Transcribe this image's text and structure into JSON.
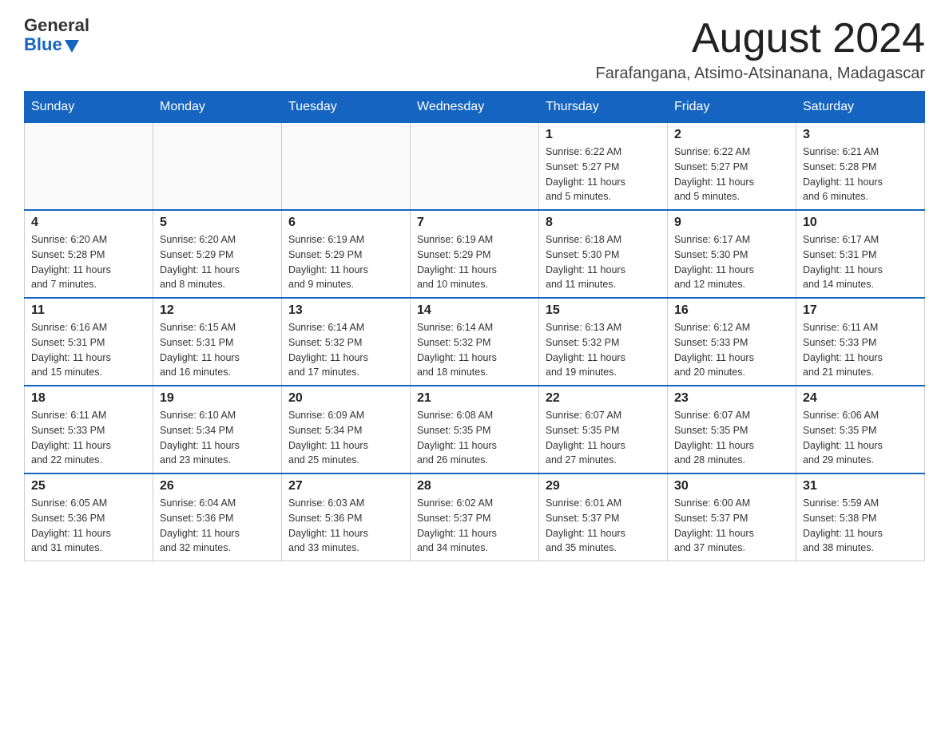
{
  "header": {
    "logo_general": "General",
    "logo_blue": "Blue",
    "month_year": "August 2024",
    "location": "Farafangana, Atsimo-Atsinanana, Madagascar"
  },
  "days_of_week": [
    "Sunday",
    "Monday",
    "Tuesday",
    "Wednesday",
    "Thursday",
    "Friday",
    "Saturday"
  ],
  "weeks": [
    {
      "days": [
        {
          "num": "",
          "info": ""
        },
        {
          "num": "",
          "info": ""
        },
        {
          "num": "",
          "info": ""
        },
        {
          "num": "",
          "info": ""
        },
        {
          "num": "1",
          "info": "Sunrise: 6:22 AM\nSunset: 5:27 PM\nDaylight: 11 hours\nand 5 minutes."
        },
        {
          "num": "2",
          "info": "Sunrise: 6:22 AM\nSunset: 5:27 PM\nDaylight: 11 hours\nand 5 minutes."
        },
        {
          "num": "3",
          "info": "Sunrise: 6:21 AM\nSunset: 5:28 PM\nDaylight: 11 hours\nand 6 minutes."
        }
      ]
    },
    {
      "days": [
        {
          "num": "4",
          "info": "Sunrise: 6:20 AM\nSunset: 5:28 PM\nDaylight: 11 hours\nand 7 minutes."
        },
        {
          "num": "5",
          "info": "Sunrise: 6:20 AM\nSunset: 5:29 PM\nDaylight: 11 hours\nand 8 minutes."
        },
        {
          "num": "6",
          "info": "Sunrise: 6:19 AM\nSunset: 5:29 PM\nDaylight: 11 hours\nand 9 minutes."
        },
        {
          "num": "7",
          "info": "Sunrise: 6:19 AM\nSunset: 5:29 PM\nDaylight: 11 hours\nand 10 minutes."
        },
        {
          "num": "8",
          "info": "Sunrise: 6:18 AM\nSunset: 5:30 PM\nDaylight: 11 hours\nand 11 minutes."
        },
        {
          "num": "9",
          "info": "Sunrise: 6:17 AM\nSunset: 5:30 PM\nDaylight: 11 hours\nand 12 minutes."
        },
        {
          "num": "10",
          "info": "Sunrise: 6:17 AM\nSunset: 5:31 PM\nDaylight: 11 hours\nand 14 minutes."
        }
      ]
    },
    {
      "days": [
        {
          "num": "11",
          "info": "Sunrise: 6:16 AM\nSunset: 5:31 PM\nDaylight: 11 hours\nand 15 minutes."
        },
        {
          "num": "12",
          "info": "Sunrise: 6:15 AM\nSunset: 5:31 PM\nDaylight: 11 hours\nand 16 minutes."
        },
        {
          "num": "13",
          "info": "Sunrise: 6:14 AM\nSunset: 5:32 PM\nDaylight: 11 hours\nand 17 minutes."
        },
        {
          "num": "14",
          "info": "Sunrise: 6:14 AM\nSunset: 5:32 PM\nDaylight: 11 hours\nand 18 minutes."
        },
        {
          "num": "15",
          "info": "Sunrise: 6:13 AM\nSunset: 5:32 PM\nDaylight: 11 hours\nand 19 minutes."
        },
        {
          "num": "16",
          "info": "Sunrise: 6:12 AM\nSunset: 5:33 PM\nDaylight: 11 hours\nand 20 minutes."
        },
        {
          "num": "17",
          "info": "Sunrise: 6:11 AM\nSunset: 5:33 PM\nDaylight: 11 hours\nand 21 minutes."
        }
      ]
    },
    {
      "days": [
        {
          "num": "18",
          "info": "Sunrise: 6:11 AM\nSunset: 5:33 PM\nDaylight: 11 hours\nand 22 minutes."
        },
        {
          "num": "19",
          "info": "Sunrise: 6:10 AM\nSunset: 5:34 PM\nDaylight: 11 hours\nand 23 minutes."
        },
        {
          "num": "20",
          "info": "Sunrise: 6:09 AM\nSunset: 5:34 PM\nDaylight: 11 hours\nand 25 minutes."
        },
        {
          "num": "21",
          "info": "Sunrise: 6:08 AM\nSunset: 5:35 PM\nDaylight: 11 hours\nand 26 minutes."
        },
        {
          "num": "22",
          "info": "Sunrise: 6:07 AM\nSunset: 5:35 PM\nDaylight: 11 hours\nand 27 minutes."
        },
        {
          "num": "23",
          "info": "Sunrise: 6:07 AM\nSunset: 5:35 PM\nDaylight: 11 hours\nand 28 minutes."
        },
        {
          "num": "24",
          "info": "Sunrise: 6:06 AM\nSunset: 5:35 PM\nDaylight: 11 hours\nand 29 minutes."
        }
      ]
    },
    {
      "days": [
        {
          "num": "25",
          "info": "Sunrise: 6:05 AM\nSunset: 5:36 PM\nDaylight: 11 hours\nand 31 minutes."
        },
        {
          "num": "26",
          "info": "Sunrise: 6:04 AM\nSunset: 5:36 PM\nDaylight: 11 hours\nand 32 minutes."
        },
        {
          "num": "27",
          "info": "Sunrise: 6:03 AM\nSunset: 5:36 PM\nDaylight: 11 hours\nand 33 minutes."
        },
        {
          "num": "28",
          "info": "Sunrise: 6:02 AM\nSunset: 5:37 PM\nDaylight: 11 hours\nand 34 minutes."
        },
        {
          "num": "29",
          "info": "Sunrise: 6:01 AM\nSunset: 5:37 PM\nDaylight: 11 hours\nand 35 minutes."
        },
        {
          "num": "30",
          "info": "Sunrise: 6:00 AM\nSunset: 5:37 PM\nDaylight: 11 hours\nand 37 minutes."
        },
        {
          "num": "31",
          "info": "Sunrise: 5:59 AM\nSunset: 5:38 PM\nDaylight: 11 hours\nand 38 minutes."
        }
      ]
    }
  ]
}
